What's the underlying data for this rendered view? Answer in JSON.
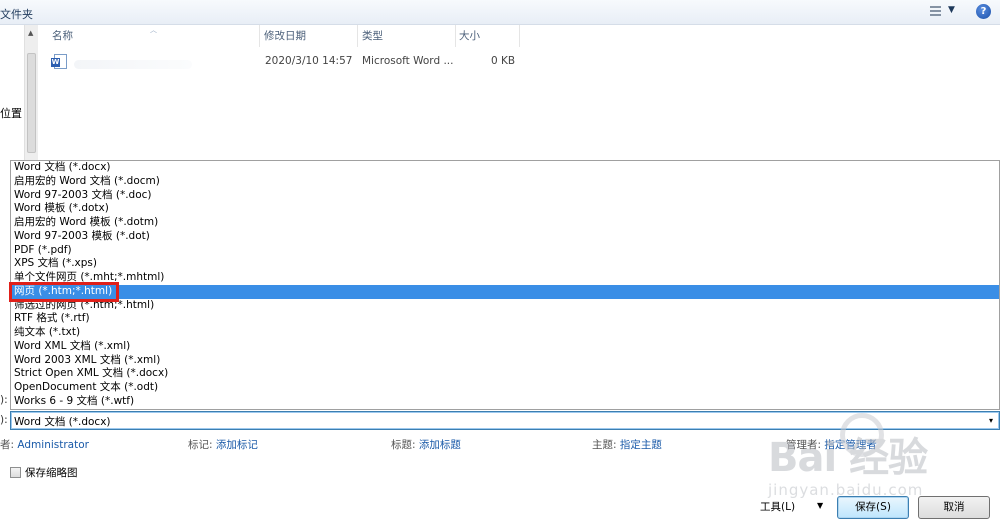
{
  "toolbar": {
    "title": "文件夹",
    "help_label": "?",
    "view_caret": "▼"
  },
  "nav": {
    "location_label": "位置"
  },
  "columns": {
    "name": "名称",
    "modified": "修改日期",
    "type": "类型",
    "size": "大小"
  },
  "file": {
    "modified": "2020/3/10 14:57",
    "type": "Microsoft Word ...",
    "size": "0 KB"
  },
  "save_type_options": [
    "Word 文档 (*.docx)",
    "启用宏的 Word 文档 (*.docm)",
    "Word 97-2003 文档 (*.doc)",
    "Word 模板 (*.dotx)",
    "启用宏的 Word 模板 (*.dotm)",
    "Word 97-2003 模板 (*.dot)",
    "PDF (*.pdf)",
    "XPS 文档 (*.xps)",
    "单个文件网页 (*.mht;*.mhtml)",
    "网页 (*.htm;*.html)",
    "筛选过的网页 (*.htm;*.html)",
    "RTF 格式 (*.rtf)",
    "纯文本 (*.txt)",
    "Word XML 文档 (*.xml)",
    "Word 2003 XML 文档 (*.xml)",
    "Strict Open XML 文档 (*.docx)",
    "OpenDocument 文本 (*.odt)",
    "Works 6 - 9 文档 (*.wtf)"
  ],
  "selected_option_index": 9,
  "save_type": {
    "label_fragment": "):",
    "value": "Word 文档 (*.docx)",
    "caret": "▾"
  },
  "file_name_label_fragment": "):",
  "metadata": {
    "author_key": "者:",
    "author_value": "Administrator",
    "tags_key": "标记:",
    "tags_value": "添加标记",
    "title_key": "标题:",
    "title_value": "添加标题",
    "subject_key": "主题:",
    "subject_value": "指定主题",
    "manager_key": "管理者:",
    "manager_value": "指定管理者"
  },
  "thumbnail": {
    "label": "保存缩略图",
    "checked": false
  },
  "buttons": {
    "tools": "工具(L)",
    "tools_caret": "▼",
    "save": "保存(S)",
    "cancel": "取消"
  },
  "watermark": {
    "logo_text": "Bai  经验",
    "url_text": "jingyan.baidu.com"
  }
}
